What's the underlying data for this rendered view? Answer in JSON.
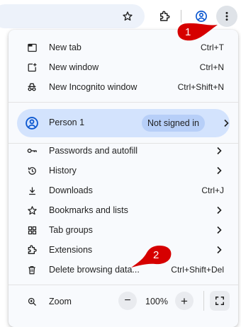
{
  "menu": {
    "items_top": [
      {
        "label": "New tab",
        "shortcut": "Ctrl+T",
        "icon": "new-tab-icon"
      },
      {
        "label": "New window",
        "shortcut": "Ctrl+N",
        "icon": "new-window-icon"
      },
      {
        "label": "New Incognito window",
        "shortcut": "Ctrl+Shift+N",
        "icon": "incognito-icon"
      }
    ],
    "profile": {
      "name": "Person 1",
      "status": "Not signed in"
    },
    "items_mid": [
      {
        "label": "Passwords and autofill",
        "icon": "key-icon"
      },
      {
        "label": "History",
        "icon": "history-icon"
      },
      {
        "label": "Downloads",
        "shortcut": "Ctrl+J",
        "icon": "download-icon"
      },
      {
        "label": "Bookmarks and lists",
        "icon": "star-icon"
      },
      {
        "label": "Tab groups",
        "icon": "tab-groups-icon"
      },
      {
        "label": "Extensions",
        "icon": "extensions-icon"
      },
      {
        "label": "Delete browsing data...",
        "shortcut": "Ctrl+Shift+Del",
        "icon": "trash-icon"
      }
    ],
    "zoom": {
      "label": "Zoom",
      "value": "100%",
      "minus": "−",
      "plus": "+"
    }
  },
  "callouts": {
    "one": "1",
    "two": "2"
  },
  "colors": {
    "accent": "#d3e3fd",
    "callout": "#d60000",
    "profile_icon": "#0b57d0"
  }
}
